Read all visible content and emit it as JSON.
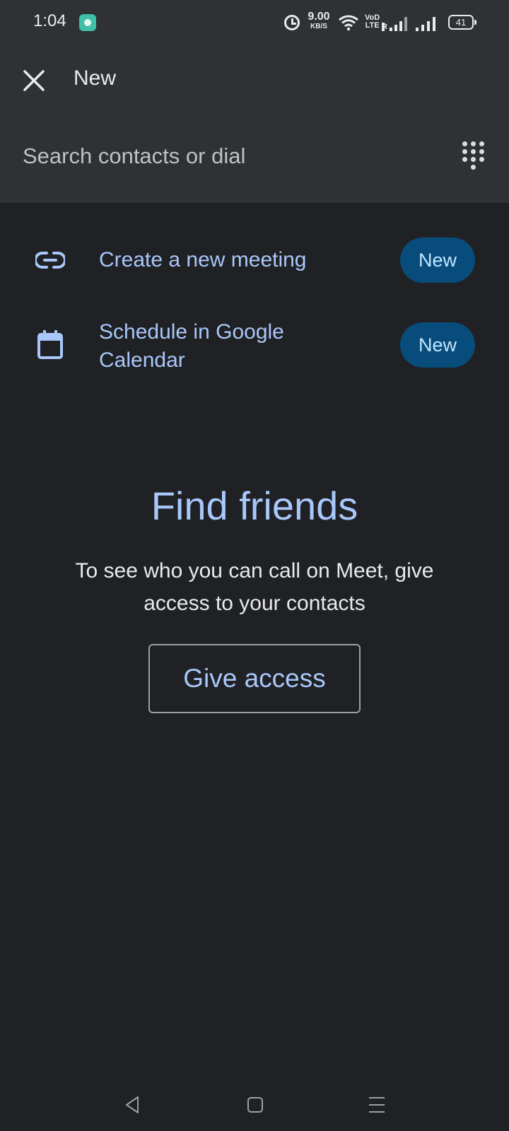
{
  "status_bar": {
    "time": "1:04",
    "speed_value": "9.00",
    "speed_unit": "KB/S",
    "volte_top": "VoD",
    "volte_bottom": "LTE",
    "roaming": "R",
    "battery": "41"
  },
  "header": {
    "title": "New",
    "close_icon": "close-icon"
  },
  "search": {
    "placeholder": "Search contacts or dial",
    "dialpad_icon": "dialpad-icon"
  },
  "actions": [
    {
      "icon": "link-icon",
      "label": "Create a new meeting",
      "badge": "New"
    },
    {
      "icon": "calendar-icon",
      "label": "Schedule in Google Calendar",
      "badge": "New"
    }
  ],
  "find_friends": {
    "title": "Find friends",
    "description": "To see who you can call on Meet, give access to your contacts",
    "button": "Give access"
  },
  "nav_bar": {
    "back": "back-icon",
    "home": "home-icon",
    "recents": "recents-icon"
  },
  "colors": {
    "background": "#202124",
    "header_background": "#303134",
    "accent": "#a8c7fa",
    "badge": "#074c7b"
  }
}
